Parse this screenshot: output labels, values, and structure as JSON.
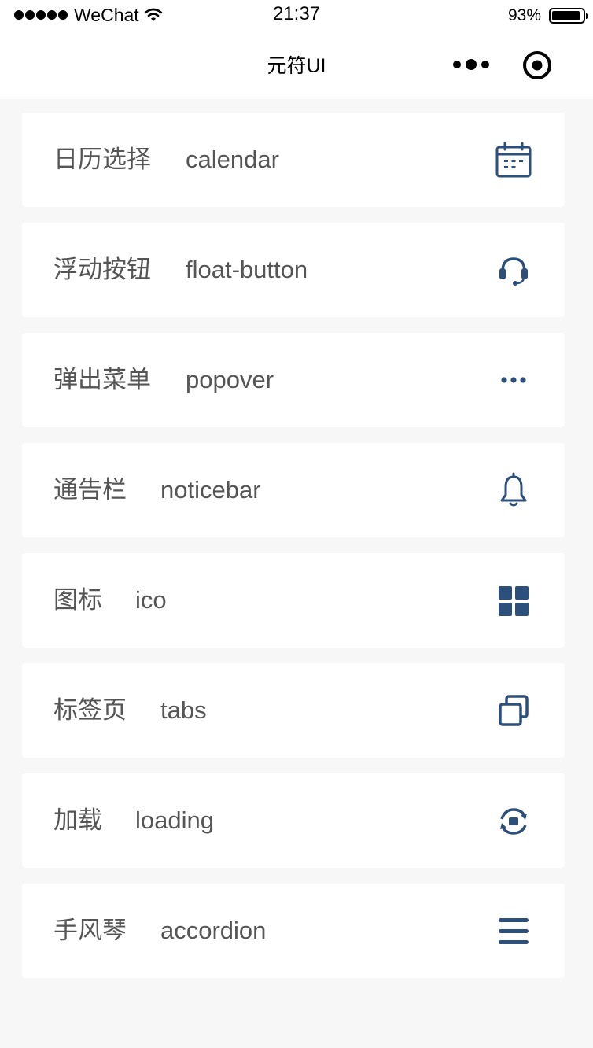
{
  "status_bar": {
    "carrier": "WeChat",
    "time": "21:37",
    "battery_percent_text": "93%",
    "battery_level": 0.93
  },
  "nav": {
    "title": "元符UI",
    "more_icon": "more-dots-icon",
    "close_icon": "target-close-icon"
  },
  "theme": {
    "icon_color": "#2c4f7c",
    "text_color": "#555555",
    "page_background": "#f7f7f7",
    "card_background": "#ffffff"
  },
  "items": [
    {
      "cn": "日历选择",
      "en": "calendar",
      "icon": "calendar-icon"
    },
    {
      "cn": "浮动按钮",
      "en": "float-button",
      "icon": "headset-icon"
    },
    {
      "cn": "弹出菜单",
      "en": "popover",
      "icon": "ellipsis-icon"
    },
    {
      "cn": "通告栏",
      "en": "noticebar",
      "icon": "bell-icon"
    },
    {
      "cn": "图标",
      "en": "ico",
      "icon": "grid-icon"
    },
    {
      "cn": "标签页",
      "en": "tabs",
      "icon": "copy-icon"
    },
    {
      "cn": "加载",
      "en": "loading",
      "icon": "refresh-icon"
    },
    {
      "cn": "手风琴",
      "en": "accordion",
      "icon": "menu-icon"
    }
  ]
}
